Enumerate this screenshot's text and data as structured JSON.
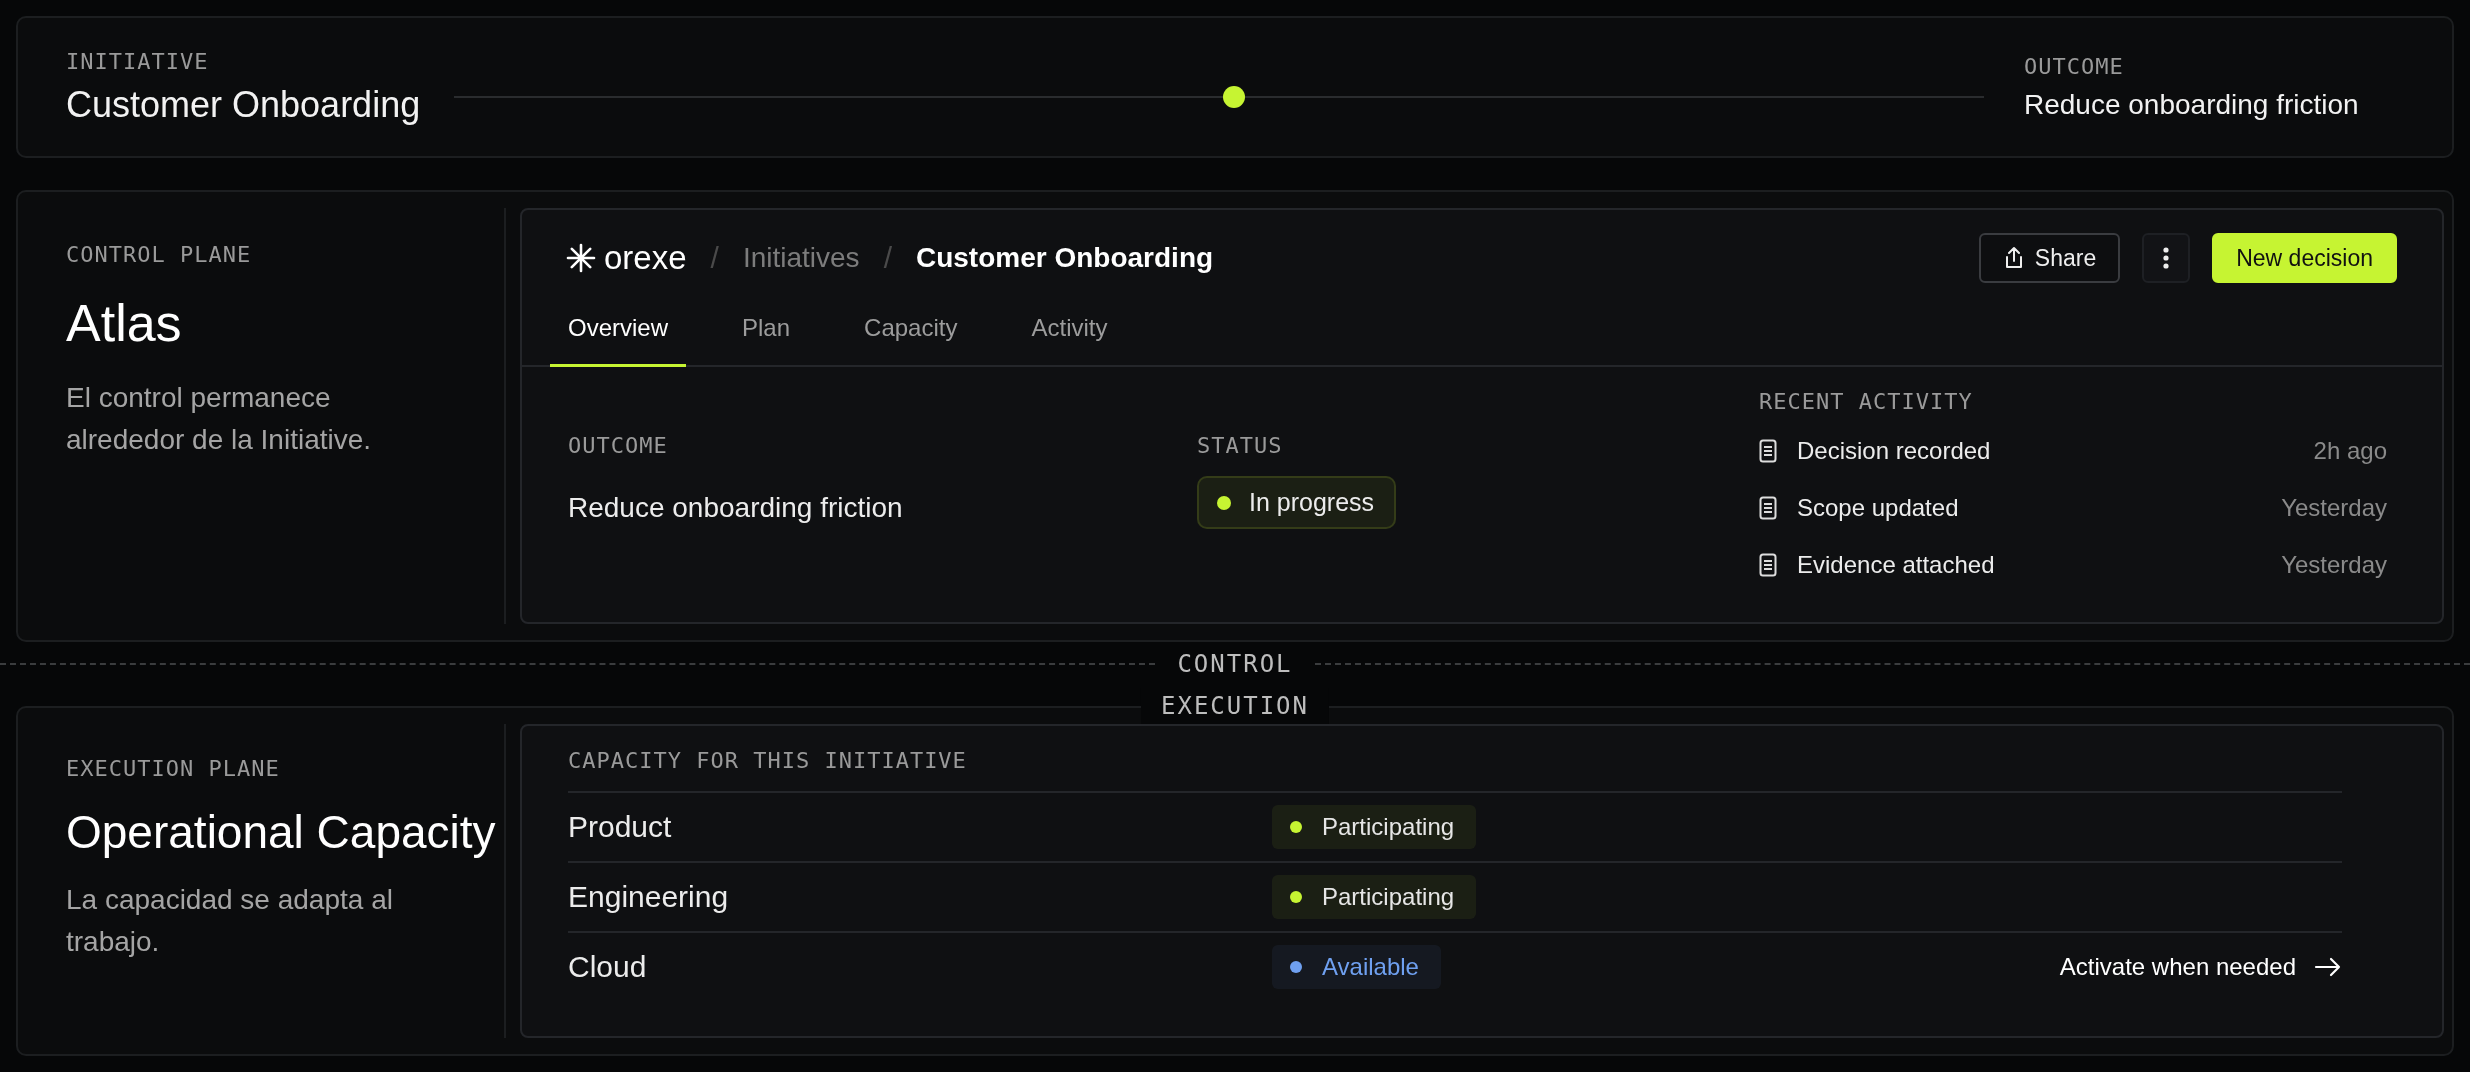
{
  "initiative": {
    "label": "INITIATIVE",
    "title": "Customer Onboarding"
  },
  "timeline": {
    "level": 0.51
  },
  "outcome_header": {
    "label": "OUTCOME",
    "value": "Reduce onboarding friction"
  },
  "control_plane": {
    "label": "CONTROL PLANE",
    "title": "Atlas",
    "description": "El control permanece alrededor de la Initiative."
  },
  "app": {
    "brand": "orexe",
    "breadcrumbs": [
      {
        "label": "Initiatives",
        "current": false
      },
      {
        "label": "Customer Onboarding",
        "current": true
      }
    ],
    "separator": "/",
    "actions": {
      "share": "Share",
      "primary": "New decision"
    },
    "tabs": [
      {
        "label": "Overview",
        "selected": true
      },
      {
        "label": "Plan",
        "selected": false
      },
      {
        "label": "Capacity",
        "selected": false
      },
      {
        "label": "Activity",
        "selected": false
      }
    ],
    "outcome": {
      "label": "OUTCOME",
      "value": "Reduce onboarding friction"
    },
    "status": {
      "label": "STATUS",
      "value": "In progress",
      "color": "#c6f432"
    },
    "recent_activity": {
      "label": "RECENT ACTIVITY",
      "items": [
        {
          "text": "Decision recorded",
          "time": "2h ago"
        },
        {
          "text": "Scope updated",
          "time": "Yesterday"
        },
        {
          "text": "Evidence attached",
          "time": "Yesterday"
        }
      ]
    }
  },
  "divider": {
    "upper": "CONTROL",
    "lower": "EXECUTION"
  },
  "execution_plane": {
    "label": "EXECUTION PLANE",
    "title": "Operational Capacity",
    "description": "La capacidad se adapta al trabajo."
  },
  "capacity": {
    "label": "CAPACITY FOR THIS INITIATIVE",
    "rows": [
      {
        "name": "Product",
        "status": "Participating",
        "color": "#c6f432"
      },
      {
        "name": "Engineering",
        "status": "Participating",
        "color": "#c6f432"
      },
      {
        "name": "Cloud",
        "status": "Available",
        "color": "#6fa0f0",
        "action": "Activate when needed"
      }
    ]
  }
}
